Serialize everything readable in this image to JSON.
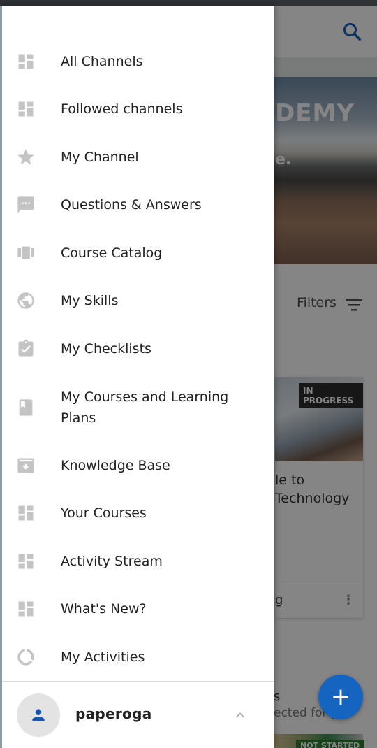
{
  "background": {
    "hero_title": "DEMY",
    "hero_subtitle": "e.",
    "filters_label": "Filters",
    "card": {
      "badge": "IN PROGRESS",
      "title_line1": "le to",
      "title_line2": "Technology",
      "footer_text": "g",
      "more_label": "⋮"
    },
    "bottom_text1": "s",
    "bottom_text2": "ected for y",
    "bottom_badge": "NOT STARTED",
    "fab_label": "+"
  },
  "drawer": {
    "items": [
      {
        "label": "All Channels",
        "icon": "dashboard-icon"
      },
      {
        "label": "Followed channels",
        "icon": "dashboard-icon"
      },
      {
        "label": "My Channel",
        "icon": "star-icon"
      },
      {
        "label": "Questions & Answers",
        "icon": "chat-bubble-icon"
      },
      {
        "label": "Course Catalog",
        "icon": "carousel-icon"
      },
      {
        "label": "My Skills",
        "icon": "globe-icon"
      },
      {
        "label": "My Checklists",
        "icon": "clipboard-check-icon"
      },
      {
        "label": "My Courses and Learning Plans",
        "icon": "book-icon"
      },
      {
        "label": "Knowledge Base",
        "icon": "archive-icon"
      },
      {
        "label": "Your Courses",
        "icon": "dashboard-icon"
      },
      {
        "label": "Activity Stream",
        "icon": "dashboard-icon"
      },
      {
        "label": "What's New?",
        "icon": "dashboard-icon"
      },
      {
        "label": "My Activities",
        "icon": "circle-progress-icon"
      }
    ],
    "user": {
      "name": "paperoga",
      "avatar_icon": "person-icon",
      "chevron_icon": "chevron-up-icon"
    }
  },
  "colors": {
    "icon_gray": "#c4c4c4",
    "accent_blue": "#1565c0",
    "text_dark": "#212121"
  }
}
